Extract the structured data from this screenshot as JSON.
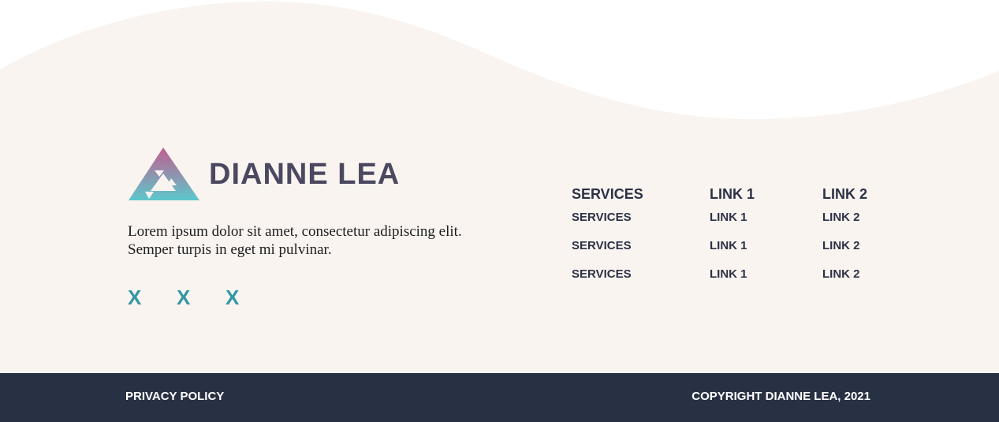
{
  "brand": {
    "name": "DIANNE LEA",
    "logo_icon": "triangle-logo-icon"
  },
  "tagline": "Lorem ipsum dolor sit amet, consectetur adipiscing elit. Semper turpis in eget mi pulvinar.",
  "social": {
    "links": [
      "X",
      "X",
      "X"
    ]
  },
  "footer_nav": {
    "columns": [
      {
        "heading": "SERVICES",
        "links": [
          "SERVICES",
          "SERVICES",
          "SERVICES"
        ]
      },
      {
        "heading": "LINK 1",
        "links": [
          "LINK 1",
          "LINK 1",
          "LINK 1"
        ]
      },
      {
        "heading": "LINK 2",
        "links": [
          "LINK 2",
          "LINK 2",
          "LINK 2"
        ]
      }
    ]
  },
  "bottom_bar": {
    "privacy_label": "PRIVACY POLICY",
    "copyright": "COPYRIGHT DIANNE LEA, 2021"
  },
  "colors": {
    "page_background": "#ffffff",
    "footer_background": "#f9f4f0",
    "bottom_bar_background": "#283044",
    "brand_text": "#4b4860",
    "nav_text": "#2c3145",
    "social_accent": "#3497a4",
    "logo_gradient_top": "#c35c8f",
    "logo_gradient_bottom": "#5cc8cc"
  }
}
